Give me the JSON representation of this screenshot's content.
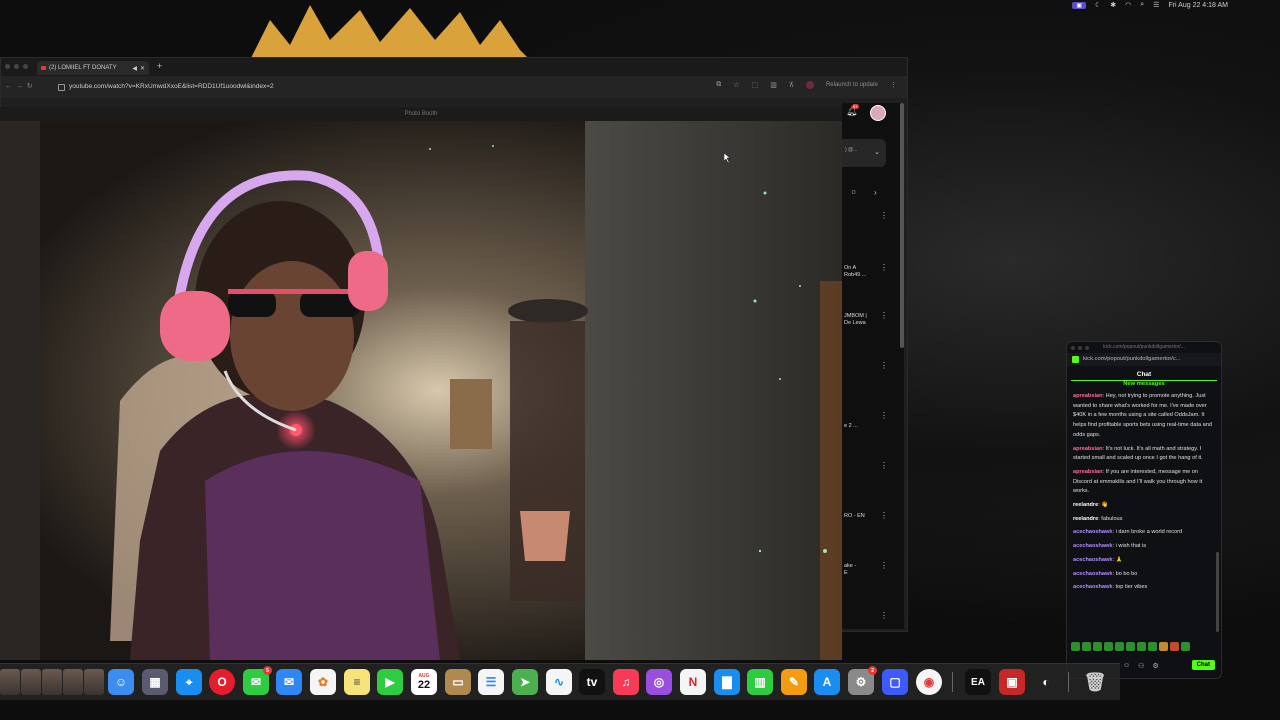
{
  "menubar": {
    "status_badge": "",
    "datetime": "Fri Aug 22  4:18 AM"
  },
  "browser": {
    "tab_title": "(2) LOMIIEL FT DONATY",
    "url": "youtube.com/watch?v=KRxUmwdXxoE&list=RDD1Uf1uoodwl&index=2",
    "relaunch_label": "Relaunch to update",
    "notification_count": "9+"
  },
  "youtube_side": {
    "dropdown_text": ") @...",
    "chip_text": "D",
    "items": [
      {
        "text": "On A\nRob49 ..."
      },
      {
        "text": "JMBOM |\nDe Lewa"
      },
      {
        "text": "e 2 ..."
      },
      {
        "text": "RO - EN"
      },
      {
        "text": "ake -\nE"
      }
    ]
  },
  "photobooth": {
    "title": "Photo Booth"
  },
  "kick": {
    "window_title": "kick.com/popout/punkdollgamertor/...",
    "url": "kick.com/popout/punkdollgamertor/c...",
    "heading": "Chat",
    "new_messages": "New messages",
    "send_label": "Chat",
    "messages": [
      {
        "user": "apreabsian",
        "color": "#ff6b9a",
        "text": "Hey, not trying to promote anything. Just wanted to share what's worked for me. I've made over $40K in a few months using a site called OddsJam. It helps find profitable sports bets using real-time data and odds gaps."
      },
      {
        "user": "apreabsian",
        "color": "#ff6b9a",
        "text": "It's not luck. It's all math and strategy. I started small and scaled up once I got the hang of it."
      },
      {
        "user": "apreabsian",
        "color": "#ff6b9a",
        "text": "If you are interested, message me on Discord at emmaklils and I'll walk you through how it works."
      },
      {
        "user": "reelandre",
        "color": "#ffffff",
        "text": "👋"
      },
      {
        "user": "reelandre",
        "color": "#ffffff",
        "text": "fabulous"
      },
      {
        "user": "acechaoshawk",
        "color": "#b18cff",
        "text": "i darn broke a world record"
      },
      {
        "user": "acechaoshawk",
        "color": "#b18cff",
        "text": "i wish that is"
      },
      {
        "user": "acechaoshawk",
        "color": "#b18cff",
        "text": "🙏"
      },
      {
        "user": "acechaoshawk",
        "color": "#b18cff",
        "text": "bo bo bo"
      },
      {
        "user": "acechaoshawk",
        "color": "#b18cff",
        "text": "top tier vibes"
      }
    ]
  },
  "dock": {
    "calendar_month": "AUG",
    "calendar_day": "22",
    "messages_badge": "5",
    "settings_badge": "2",
    "apps": [
      "finder-icon",
      "launchpad-icon",
      "safari-icon",
      "opera-icon",
      "messages-icon",
      "mail-icon",
      "photos-icon",
      "notes-icon",
      "facetime-icon",
      "calendar-icon",
      "archive-icon",
      "reminders-icon",
      "maps-icon",
      "freeform-icon",
      "tv-icon",
      "music-icon",
      "podcasts-icon",
      "news-icon",
      "keynote-icon",
      "numbers-icon",
      "pages-icon",
      "appstore-icon",
      "settings-icon",
      "proton-icon",
      "chrome-icon",
      "ea-icon",
      "screenpal-icon",
      "obs-icon",
      "trash-icon"
    ]
  }
}
